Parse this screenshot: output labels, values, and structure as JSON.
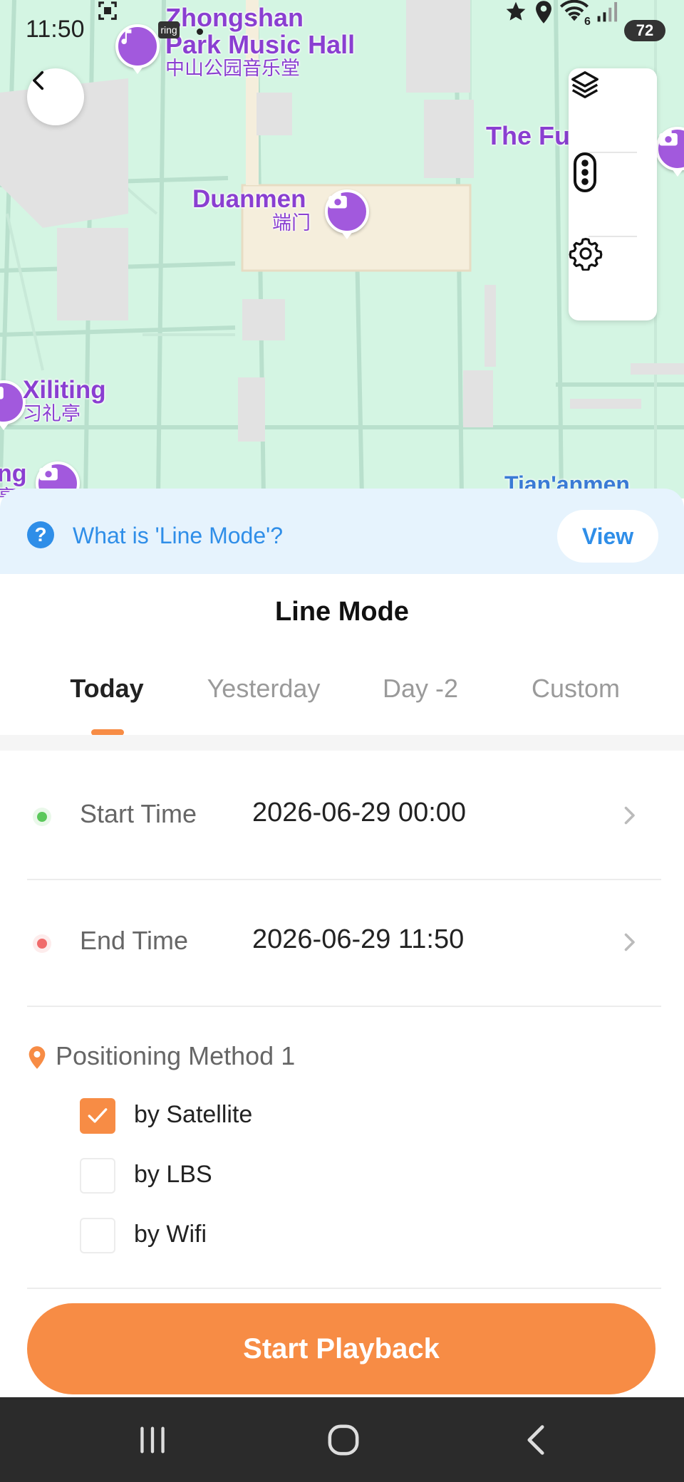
{
  "status_bar": {
    "time": "11:50",
    "battery": "72",
    "signal_badge": "6",
    "ring_badge": "ring"
  },
  "map": {
    "pois": [
      {
        "name": "Zhongshan",
        "name2": "Park Music Hall",
        "cn": "中山公园音乐堂"
      },
      {
        "name": "Duanmen",
        "cn": "端门"
      },
      {
        "name": "Xiliting",
        "cn": "习礼亭"
      },
      {
        "name": "The Fu"
      },
      {
        "name": "ng",
        "cn": "亭"
      }
    ],
    "road_label": "Tian'anmen",
    "colors": {
      "park": "#d4f5e3",
      "road": "#b9e0cd",
      "building": "#e2e2e2",
      "plaza": "#f5eedc",
      "poi": "#a259dd"
    }
  },
  "hint": {
    "text": "What is 'Line Mode'?",
    "view_label": "View"
  },
  "panel": {
    "title": "Line Mode",
    "tabs": [
      {
        "label": "Today",
        "active": true
      },
      {
        "label": "Yesterday",
        "active": false
      },
      {
        "label": "Day -2",
        "active": false
      },
      {
        "label": "Custom",
        "active": false
      }
    ],
    "start_time": {
      "label": "Start Time",
      "value": "2026-06-29 00:00"
    },
    "end_time": {
      "label": "End Time",
      "value": "2026-06-29 11:50"
    },
    "method": {
      "title": "Positioning Method 1",
      "options": [
        {
          "label": "by Satellite",
          "checked": true
        },
        {
          "label": "by LBS",
          "checked": false
        },
        {
          "label": "by Wifi",
          "checked": false
        }
      ]
    },
    "start_button": "Start Playback"
  },
  "accent_color": "#f78c45",
  "link_color": "#2f8ee8",
  "icons": [
    "back-arrow-icon",
    "layers-icon",
    "traffic-light-icon",
    "gear-icon",
    "help-icon",
    "chevron-right-icon",
    "location-pin-icon",
    "check-icon",
    "recents-icon",
    "home-icon",
    "nav-back-icon"
  ]
}
